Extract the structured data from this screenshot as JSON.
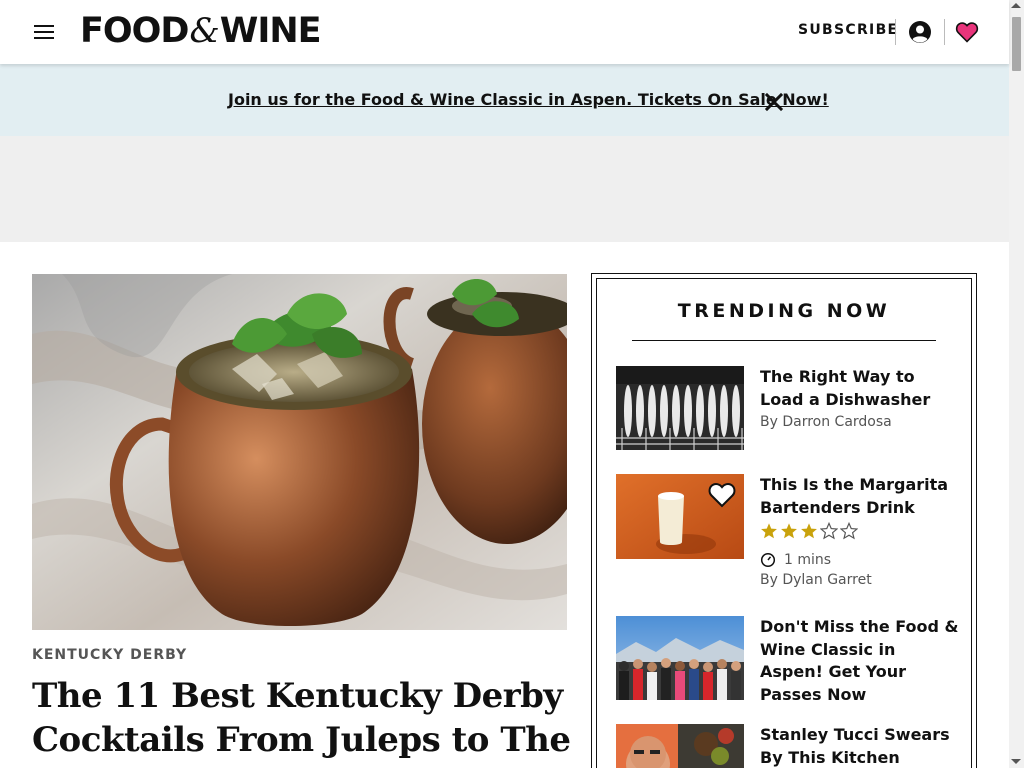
{
  "header": {
    "logo_left": "FOOD",
    "logo_amp": "&",
    "logo_right": "WINE",
    "subscribe_label": "SUBSCRIBE",
    "menu_icon": "hamburger-menu-icon",
    "account_icon": "account-circle-icon",
    "heart_icon": "heart-icon"
  },
  "promo": {
    "text": "Join us for the Food & Wine Classic in Aspen. Tickets On Sale Now!",
    "close_icon": "close-icon"
  },
  "hero": {
    "kicker": "KENTUCKY DERBY",
    "title": "The 11 Best Kentucky Derby Cocktails From Juleps to The"
  },
  "trending": {
    "heading": "TRENDING NOW",
    "items": [
      {
        "title": "The Right Way to Load a Dishwasher",
        "byline": "By Darron Cardosa"
      },
      {
        "title": "This Is the Margarita Bartenders Drink",
        "rating": 3,
        "rating_max": 5,
        "time": "1 mins",
        "byline": "By Dylan Garret"
      },
      {
        "title": "Don't Miss the Food & Wine Classic in Aspen! Get Your Passes Now"
      },
      {
        "title": "Stanley Tucci Swears By This Kitchen Essential"
      }
    ]
  },
  "colors": {
    "brand_pink": "#e8347b",
    "promo_bg": "#e2eef2",
    "ad_bg": "#efefef",
    "star_gold": "#c9a20c"
  }
}
